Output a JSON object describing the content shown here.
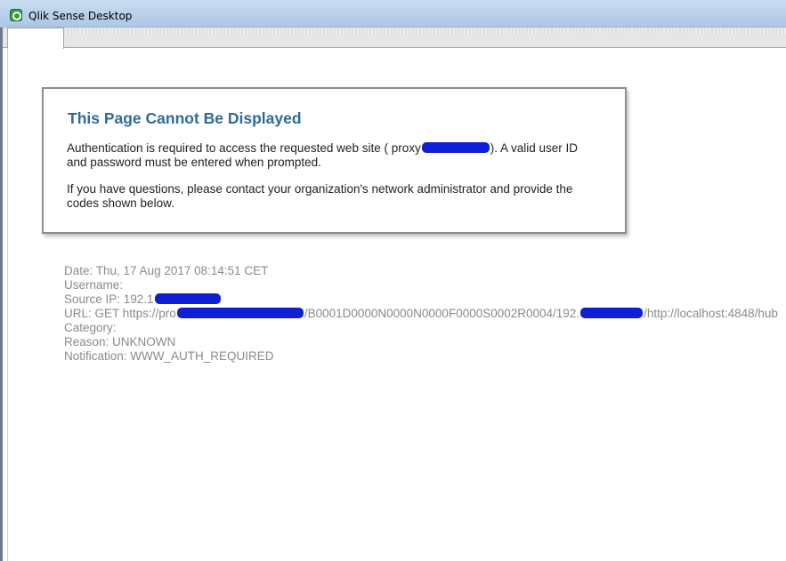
{
  "window": {
    "title": "Qlik Sense Desktop",
    "app_icon": "qlik-sense-icon"
  },
  "tabs": [
    {
      "label": ""
    }
  ],
  "error": {
    "title": "This Page Cannot Be Displayed",
    "para1_before": "Authentication is required to access the requested web site ( proxy",
    "para1_after": "). A valid user ID and password must be entered when prompted.",
    "para2": "If you have questions, please contact your organization's network administrator and provide the codes shown below."
  },
  "details": {
    "date": "Date: Thu, 17 Aug 2017 08:14:51 CET",
    "username": "Username:",
    "source_ip_prefix": "Source IP: 192.1",
    "url_prefix": "URL: GET https://pro",
    "url_middle": "/B0001D0000N0000N0000F0000S0002R0004/192.",
    "url_suffix": "/http://localhost:4848/hub",
    "category": "Category:",
    "reason": "Reason: UNKNOWN",
    "notification": "Notification: WWW_AUTH_REQUIRED"
  },
  "colors": {
    "title_blue": "#2e6a9a",
    "redaction_blue": "#0f1fd6",
    "detail_gray": "#8a8a8a"
  }
}
